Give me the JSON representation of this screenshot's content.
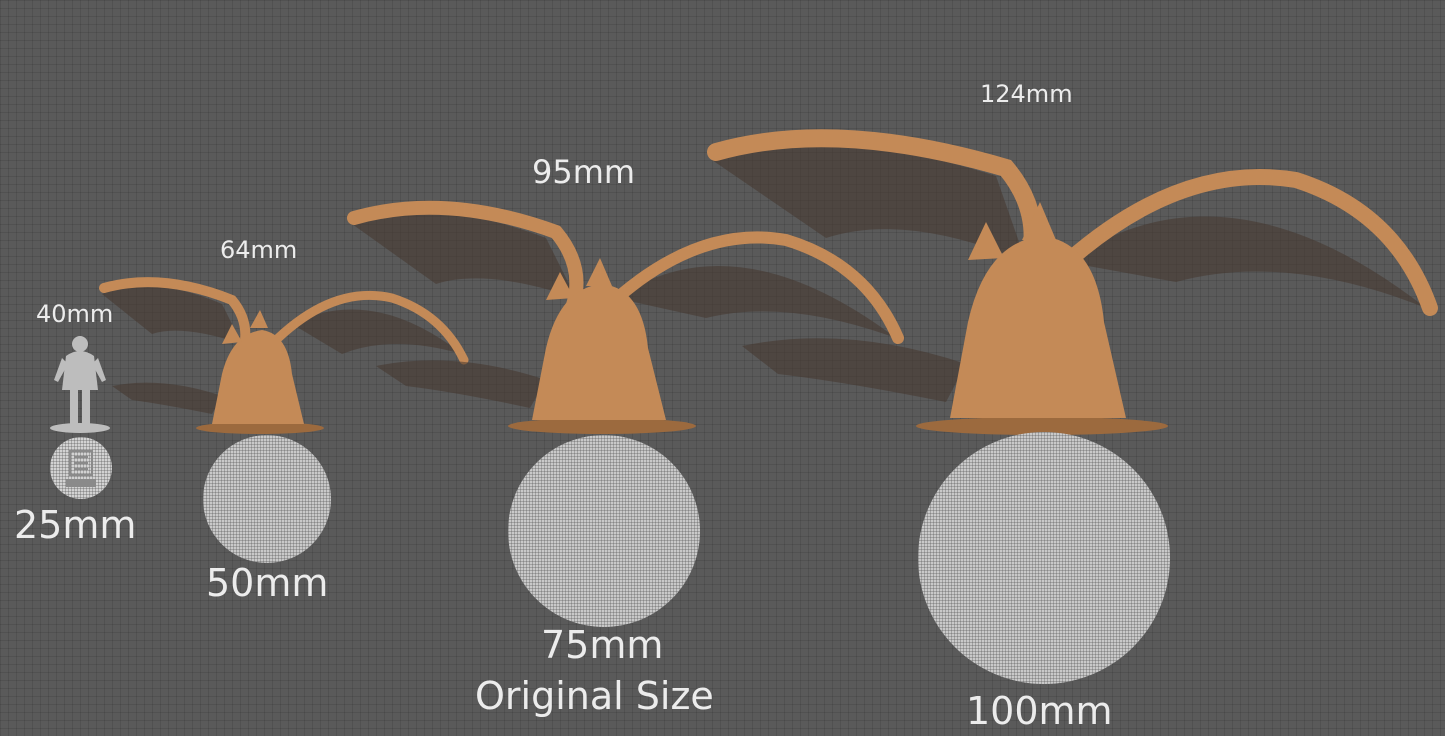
{
  "heights": {
    "h40": "40mm",
    "h64": "64mm",
    "h95": "95mm",
    "h124": "124mm"
  },
  "bases": {
    "b25": "25mm",
    "b50": "50mm",
    "b75": "75mm",
    "b75_note": "Original Size",
    "b100": "100mm"
  },
  "colors": {
    "background": "#5a5a5a",
    "miniature": "#c48a57",
    "reference": "#bdbdbd",
    "text": "#ececec"
  }
}
